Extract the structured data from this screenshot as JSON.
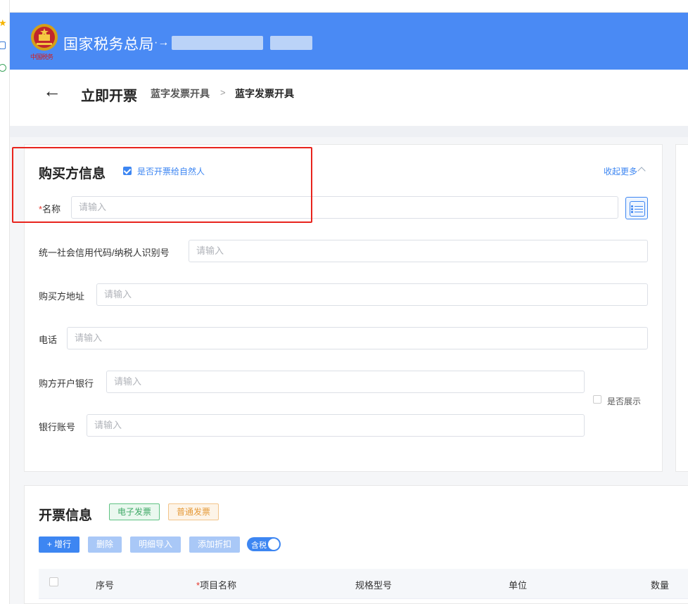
{
  "header": {
    "brand": "国家税务总局",
    "brand_suffix": "·→",
    "emblem_script": "中国税务"
  },
  "breadcrumb": {
    "back_icon": "arrow-left-icon",
    "title": "立即开票",
    "crumb1": "蓝字发票开具",
    "separator": ">",
    "crumb2": "蓝字发票开具"
  },
  "buyer": {
    "title": "购买方信息",
    "natural_person_label": "是否开票给自然人",
    "natural_person_checked": true,
    "collapse_label": "收起更多",
    "fields": {
      "name": {
        "label": "名称",
        "required_mark": "*",
        "placeholder": "请输入"
      },
      "tax_id": {
        "label": "统一社会信用代码/纳税人识别号",
        "placeholder": "请输入"
      },
      "address": {
        "label": "购买方地址",
        "placeholder": "请输入"
      },
      "phone": {
        "label": "电话",
        "placeholder": "请输入"
      },
      "bank": {
        "label": "购方开户银行",
        "placeholder": "请输入"
      },
      "account": {
        "label": "银行账号",
        "placeholder": "请输入"
      }
    },
    "show_label": "是否展示",
    "show_checked": false
  },
  "invoice": {
    "title": "开票信息",
    "tag_electronic": "电子发票",
    "tag_normal": "普通发票",
    "buttons": {
      "add_row": "+ 增行",
      "delete": "删除",
      "detail_import": "明细导入",
      "add_discount": "添加折扣"
    },
    "tax_included_label": "含税",
    "tax_included_on": true,
    "columns": {
      "index": "序号",
      "item_name": "项目名称",
      "item_required_mark": "*",
      "spec": "规格型号",
      "unit": "单位",
      "quantity": "数量"
    }
  },
  "colors": {
    "header_bg": "#4a8af4",
    "primary": "#3d86f2",
    "highlight_box": "#e8241d"
  }
}
